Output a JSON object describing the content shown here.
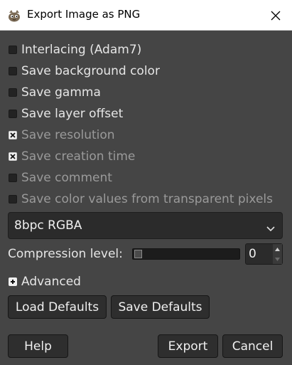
{
  "window": {
    "title": "Export Image as PNG"
  },
  "options": [
    {
      "label": "Interlacing (Adam7)",
      "checked": false,
      "disabled": false
    },
    {
      "label": "Save background color",
      "checked": false,
      "disabled": false
    },
    {
      "label": "Save gamma",
      "checked": false,
      "disabled": false
    },
    {
      "label": "Save layer offset",
      "checked": false,
      "disabled": false
    },
    {
      "label": "Save resolution",
      "checked": true,
      "disabled": true
    },
    {
      "label": "Save creation time",
      "checked": true,
      "disabled": true
    },
    {
      "label": "Save comment",
      "checked": false,
      "disabled": true
    },
    {
      "label": "Save color values from transparent pixels",
      "checked": false,
      "disabled": true
    }
  ],
  "format": {
    "selected": "8bpc RGBA"
  },
  "compression": {
    "label": "Compression level:",
    "value": "0",
    "level_fraction": 0
  },
  "advanced": {
    "label": "Advanced"
  },
  "buttons": {
    "load_defaults": "Load Defaults",
    "save_defaults": "Save Defaults",
    "help": "Help",
    "export": "Export",
    "cancel": "Cancel"
  }
}
